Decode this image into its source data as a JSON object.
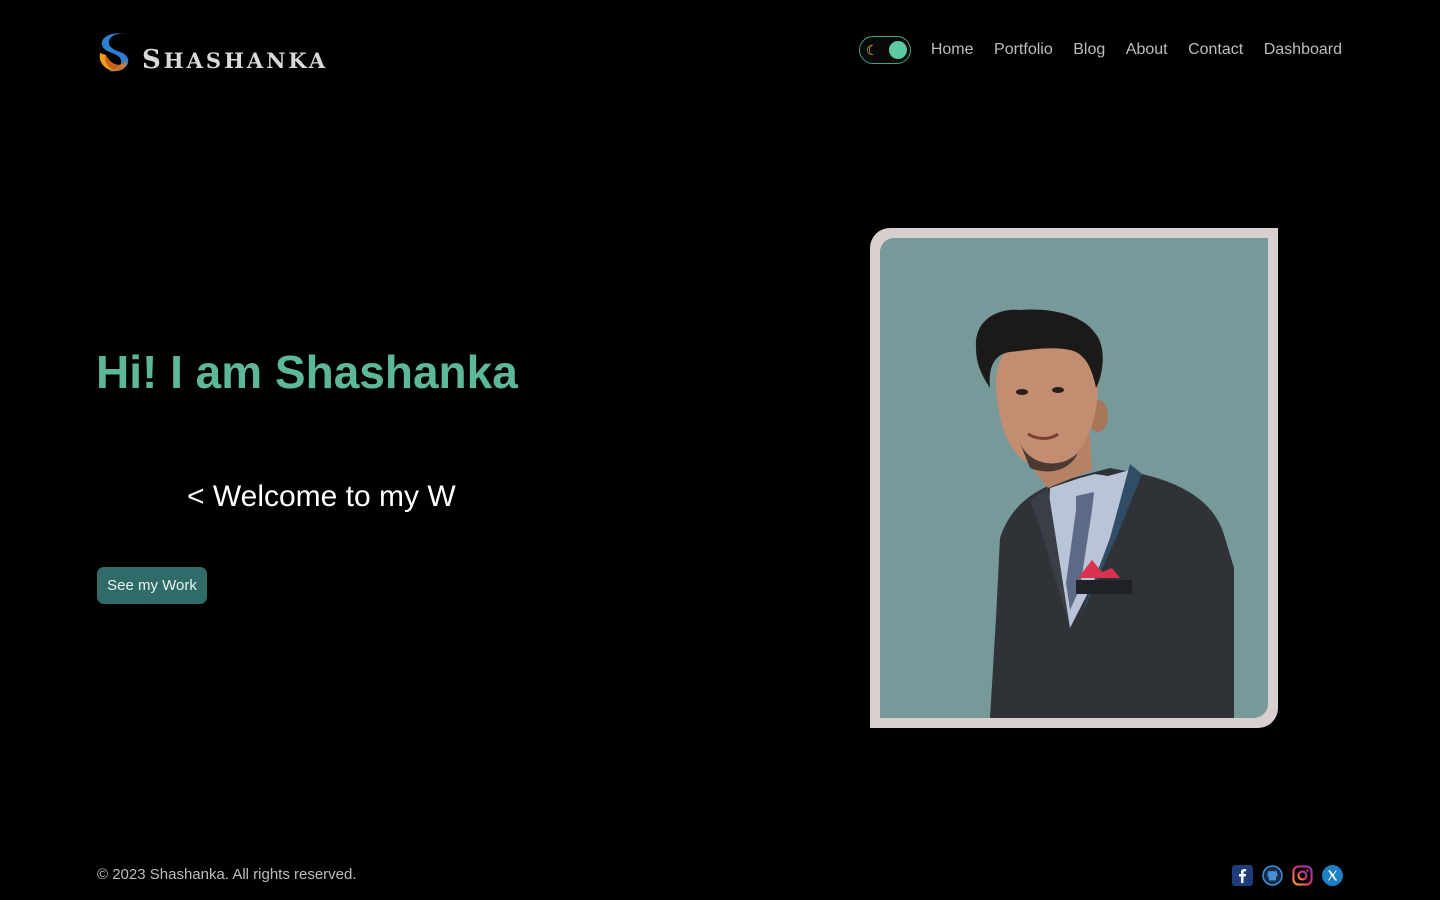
{
  "header": {
    "brand": "Shashanka",
    "brand_initial": "S",
    "brand_rest": "HASHANKA",
    "theme_toggle": {
      "icon": "moon-icon",
      "state": "dark"
    },
    "nav": [
      {
        "label": "Home"
      },
      {
        "label": "Portfolio"
      },
      {
        "label": "Blog"
      },
      {
        "label": "About"
      },
      {
        "label": "Contact"
      },
      {
        "label": "Dashboard"
      }
    ]
  },
  "hero": {
    "title": "Hi! I am Shashanka",
    "typing_text": "< Welcome to my W",
    "cta_label": "See my Work"
  },
  "footer": {
    "copyright": "© 2023 Shashanka. All rights reserved.",
    "socials": [
      {
        "icon": "facebook-icon"
      },
      {
        "icon": "github-icon"
      },
      {
        "icon": "instagram-icon"
      },
      {
        "icon": "x-twitter-icon"
      }
    ]
  },
  "colors": {
    "background": "#000000",
    "accent": "#5db89a",
    "button": "#2f6b68",
    "frame": "#d8cfcf",
    "photo_bg": "#78999a"
  }
}
